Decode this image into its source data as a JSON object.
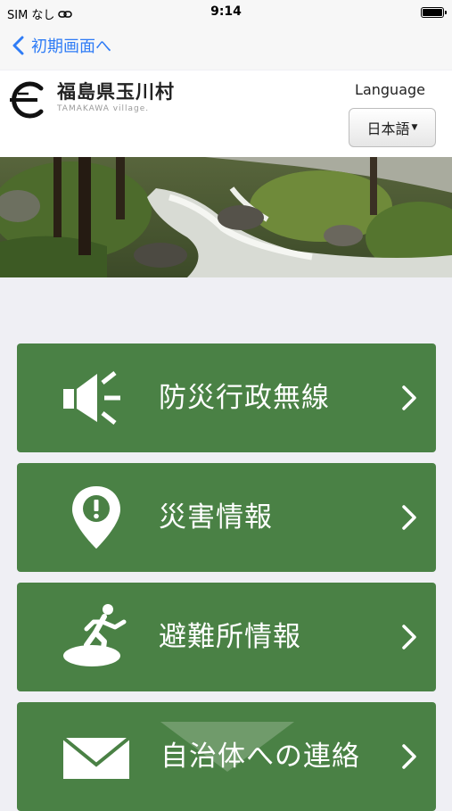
{
  "status_bar": {
    "carrier": "SIM なし",
    "time": "9:14",
    "link_icon": "link-icon",
    "battery_icon": "battery-icon"
  },
  "nav": {
    "back_label": "初期画面へ",
    "back_icon": "chevron-left-icon"
  },
  "header": {
    "logo_title": "福島県玉川村",
    "logo_subtitle": "TAMAKAWA village.",
    "language_label": "Language",
    "language_value": "日本語"
  },
  "hero": {
    "image": "mountain-stream-photo"
  },
  "menu": [
    {
      "label": "防災行政無線",
      "icon": "megaphone-icon"
    },
    {
      "label": "災害情報",
      "icon": "location-alert-icon"
    },
    {
      "label": "避難所情報",
      "icon": "evacuation-icon"
    },
    {
      "label": "自治体への連絡",
      "icon": "mail-icon"
    }
  ],
  "colors": {
    "menu_green": "#4a8145",
    "back_blue": "#2f7cf6",
    "background": "#efeff4"
  }
}
